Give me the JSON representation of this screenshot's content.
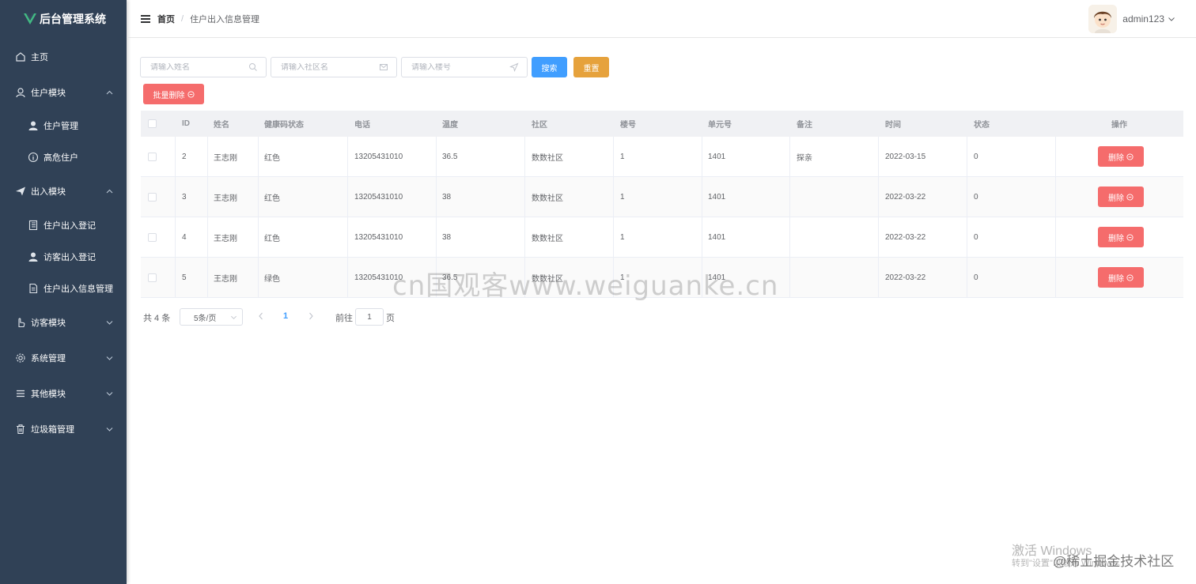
{
  "app": {
    "title": "后台管理系统"
  },
  "sidebar": {
    "items": [
      {
        "label": "主页",
        "icon": "home-icon"
      },
      {
        "label": "住户模块",
        "icon": "user-icon",
        "expanded": true
      },
      {
        "label": "住户管理",
        "icon": "user-filled-icon"
      },
      {
        "label": "高危住户",
        "icon": "info-circle-icon"
      },
      {
        "label": "出入模块",
        "icon": "send-icon",
        "expanded": true
      },
      {
        "label": "住户出入登记",
        "icon": "notebook-icon"
      },
      {
        "label": "访客出入登记",
        "icon": "user-filled-icon"
      },
      {
        "label": "住户出入信息管理",
        "icon": "document-icon"
      },
      {
        "label": "访客模块",
        "icon": "pointer-icon",
        "expanded": false
      },
      {
        "label": "系统管理",
        "icon": "setting-icon",
        "expanded": false
      },
      {
        "label": "其他模块",
        "icon": "menu-icon",
        "expanded": false
      },
      {
        "label": "垃圾箱管理",
        "icon": "delete-icon",
        "expanded": false
      }
    ]
  },
  "header": {
    "breadcrumb_home": "首页",
    "breadcrumb_sep": "/",
    "breadcrumb_current": "住户出入信息管理",
    "username": "admin123"
  },
  "search": {
    "name_placeholder": "请输入姓名",
    "community_placeholder": "请输入社区名",
    "building_placeholder": "请输入楼号",
    "search_label": "搜索",
    "reset_label": "重置",
    "batch_delete_label": "批量删除"
  },
  "table": {
    "columns": [
      "ID",
      "姓名",
      "健康码状态",
      "电话",
      "温度",
      "社区",
      "楼号",
      "单元号",
      "备注",
      "时间",
      "状态",
      "操作"
    ],
    "delete_label": "删除",
    "rows": [
      {
        "id": "2",
        "name": "王志刚",
        "health": "红色",
        "phone": "13205431010",
        "temp": "36.5",
        "community": "数数社区",
        "building": "1",
        "unit": "1401",
        "remark": "探亲",
        "time": "2022-03-15",
        "status": "0"
      },
      {
        "id": "3",
        "name": "王志刚",
        "health": "红色",
        "phone": "13205431010",
        "temp": "38",
        "community": "数数社区",
        "building": "1",
        "unit": "1401",
        "remark": "",
        "time": "2022-03-22",
        "status": "0"
      },
      {
        "id": "4",
        "name": "王志刚",
        "health": "红色",
        "phone": "13205431010",
        "temp": "38",
        "community": "数数社区",
        "building": "1",
        "unit": "1401",
        "remark": "",
        "time": "2022-03-22",
        "status": "0"
      },
      {
        "id": "5",
        "name": "王志刚",
        "health": "绿色",
        "phone": "13205431010",
        "temp": "36.5",
        "community": "数数社区",
        "building": "1",
        "unit": "1401",
        "remark": "",
        "time": "2022-03-22",
        "status": "0"
      }
    ]
  },
  "pagination": {
    "total_text": "共 4 条",
    "page_size": "5条/页",
    "current_page": "1",
    "goto_label": "前往",
    "goto_value": "1",
    "page_suffix": "页"
  },
  "watermarks": {
    "center": "cn国观客www.weiguanke.cn",
    "windows_line1": "激活 Windows",
    "windows_line2": "转到\"设置\"以激活 Windows。",
    "juejin": "@稀土掘金技术社区"
  },
  "colors": {
    "sidebar_bg": "#304156",
    "primary": "#409eff",
    "warning": "#e6a23c",
    "danger": "#f56c6c",
    "logo_green": "#42b983"
  }
}
